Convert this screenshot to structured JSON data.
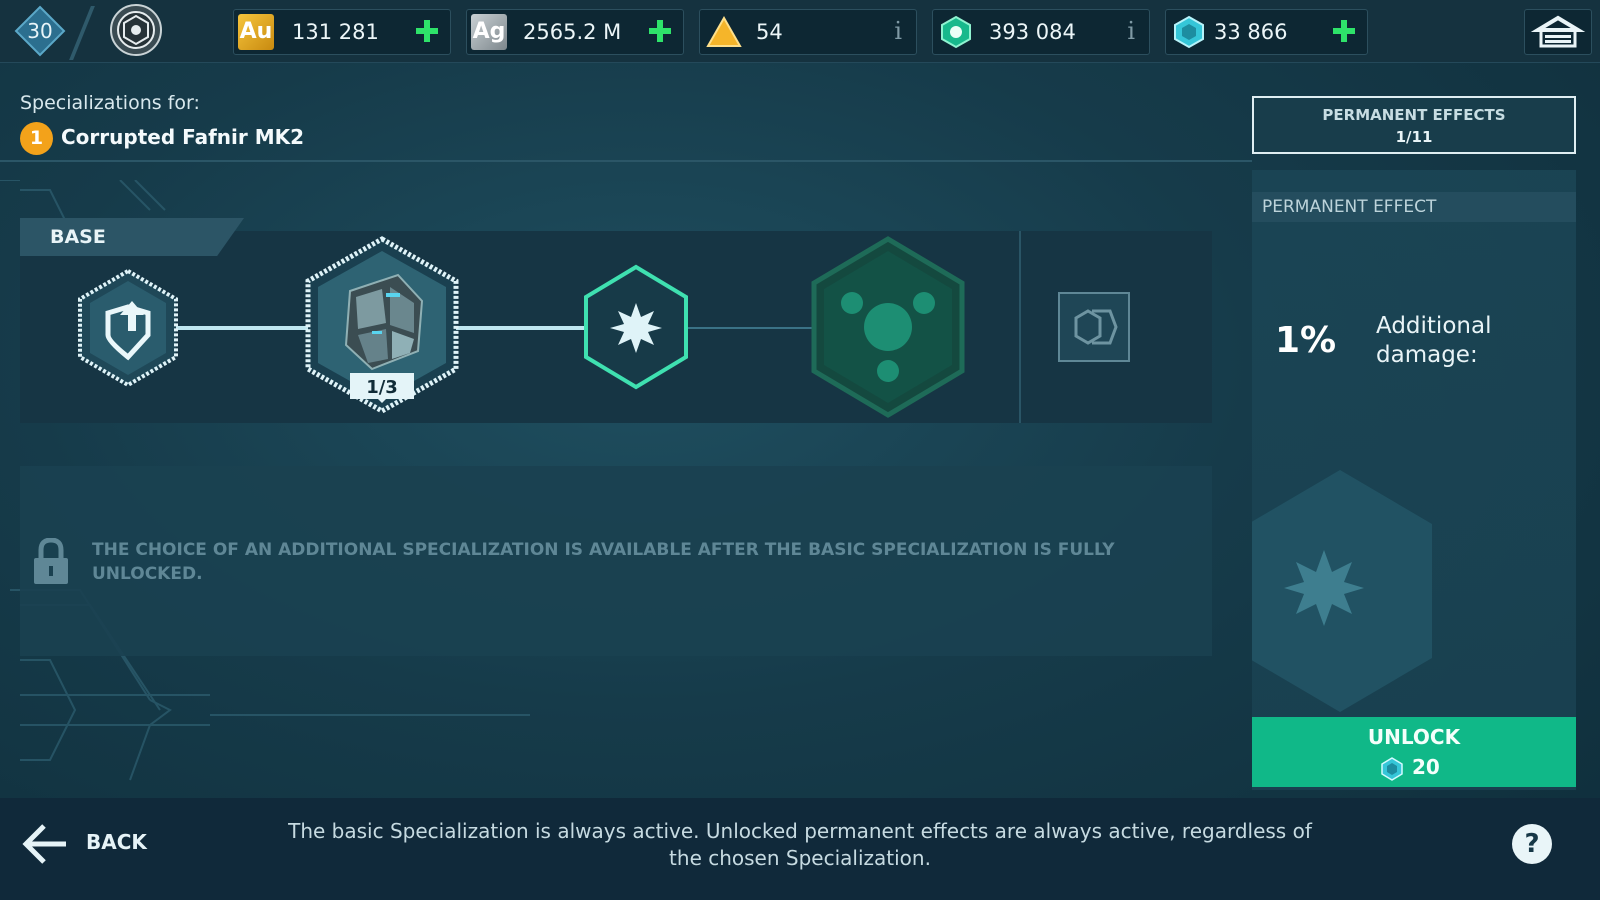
{
  "player": {
    "level": "30"
  },
  "resources": {
    "gold": {
      "symbol": "Au",
      "value": "131 281"
    },
    "silver": {
      "symbol": "Ag",
      "value": "2565.2 M"
    },
    "triangle": {
      "value": "54"
    },
    "green_gem": {
      "value": "393 084"
    },
    "cyan_gem": {
      "value": "33 866"
    }
  },
  "header": {
    "spec_for": "Specializations for:",
    "rank": "1",
    "ship_name": "Corrupted Fafnir MK2"
  },
  "permanent_effects_button": {
    "title": "PERMANENT EFFECTS",
    "count": "1/11"
  },
  "base": {
    "label": "BASE",
    "node_progress": "1/3"
  },
  "locked_message": "THE CHOICE OF AN ADDITIONAL SPECIALIZATION IS AVAILABLE AFTER THE BASIC SPECIALIZATION IS FULLY UNLOCKED.",
  "effect_panel": {
    "header": "PERMANENT EFFECT",
    "value": "1%",
    "description": "Additional damage:"
  },
  "unlock": {
    "label": "UNLOCK",
    "cost": "20"
  },
  "footer": {
    "back_label": "BACK",
    "message": "The basic Specialization is always active. Unlocked permanent effects are always active, regardless of the chosen Specialization.",
    "help": "?"
  },
  "colors": {
    "accent_green": "#10b888",
    "plus_green": "#2ee36a",
    "gold_badge": "#f3a21a",
    "node_teal": "#3fe0b0"
  }
}
